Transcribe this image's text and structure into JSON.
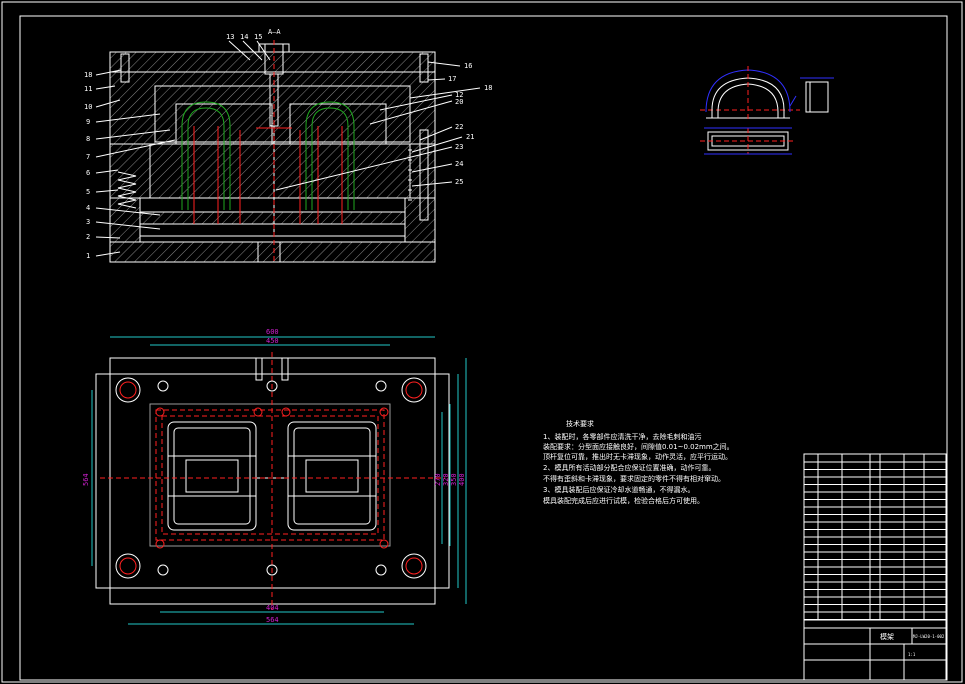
{
  "section_label": "A—A",
  "part_numbers_left": [
    "18",
    "11",
    "10",
    "9",
    "8",
    "7",
    "6",
    "5",
    "4",
    "3",
    "2",
    "1"
  ],
  "part_numbers_top": [
    "13",
    "14",
    "15"
  ],
  "part_numbers_right": [
    "16",
    "17",
    "18",
    "12",
    "20",
    "22",
    "21",
    "23",
    "24",
    "25"
  ],
  "dimensions": {
    "top_outer": "600",
    "top_inner": "450",
    "bottom_inner": "404",
    "bottom_outer": "564",
    "left_height": "564",
    "right_1": "270",
    "right_2": "320",
    "right_3": "350",
    "right_4": "400"
  },
  "notes_title": "技术要求",
  "notes": [
    "1、装配时，各零部件应清洗干净，去除毛刺和油污",
    "装配要求：分型面应接触良好，间隙值0.01~0.02mm之间。",
    "顶杆复位可靠，推出时无卡滞现象，动作灵活，应平行运动。",
    "2、模具所有活动部分配合应保证位置准确，动作可靠。",
    "不得有歪斜和卡滞现象，要求固定的零件不得有相对窜动。",
    "3、模具装配后应保证冷却水道畅通，不得漏水。",
    "模具装配完成后应进行试模，检验合格后方可使用。"
  ],
  "title_block": {
    "title": "模架",
    "drawing_no": "MJ-LW20-1-002",
    "scale": "1:1"
  }
}
